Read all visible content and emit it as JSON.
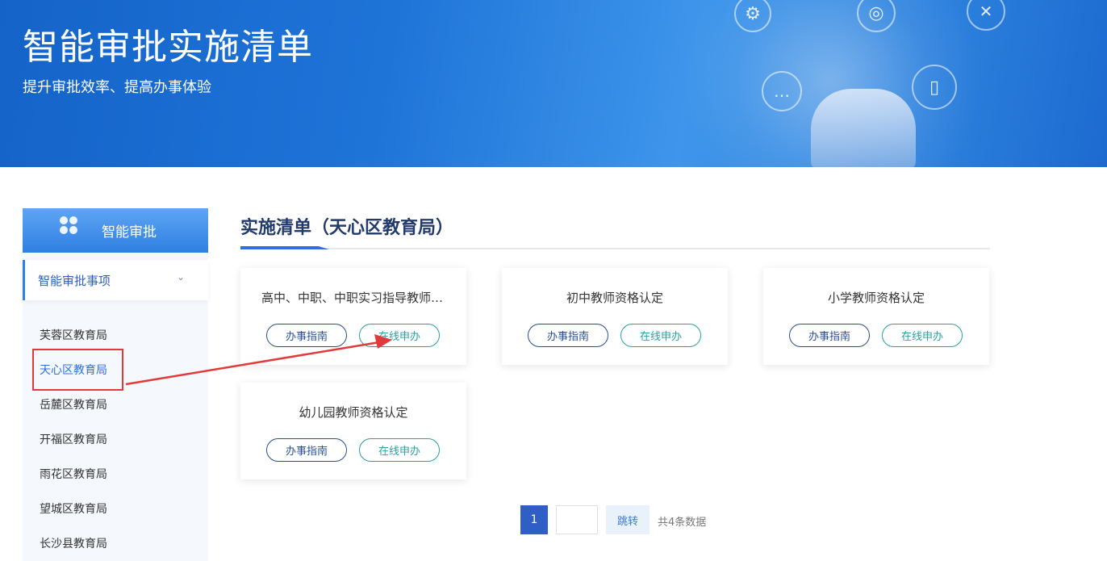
{
  "banner": {
    "title": "智能审批实施清单",
    "subtitle": "提升审批效率、提高办事体验"
  },
  "sidebar": {
    "header": "智能审批",
    "section_label": "智能审批事项",
    "items": [
      {
        "label": "芙蓉区教育局",
        "active": false
      },
      {
        "label": "天心区教育局",
        "active": true
      },
      {
        "label": "岳麓区教育局",
        "active": false
      },
      {
        "label": "开福区教育局",
        "active": false
      },
      {
        "label": "雨花区教育局",
        "active": false
      },
      {
        "label": "望城区教育局",
        "active": false
      },
      {
        "label": "长沙县教育局",
        "active": false
      }
    ]
  },
  "main": {
    "title": "实施清单（天心区教育局）",
    "cards": [
      {
        "title": "高中、中职、中职实习指导教师资格认定",
        "guide": "办事指南",
        "apply": "在线申办"
      },
      {
        "title": "初中教师资格认定",
        "guide": "办事指南",
        "apply": "在线申办"
      },
      {
        "title": "小学教师资格认定",
        "guide": "办事指南",
        "apply": "在线申办"
      },
      {
        "title": "幼儿园教师资格认定",
        "guide": "办事指南",
        "apply": "在线申办"
      }
    ]
  },
  "pagination": {
    "current_page": "1",
    "page_input_value": "",
    "jump_label": "跳转",
    "total_text": "共4条数据"
  },
  "colors": {
    "accent": "#2f6fe0",
    "annotation": "#e23a3a",
    "apply_button": "#2ba0a0",
    "guide_button": "#2a4f8f"
  }
}
